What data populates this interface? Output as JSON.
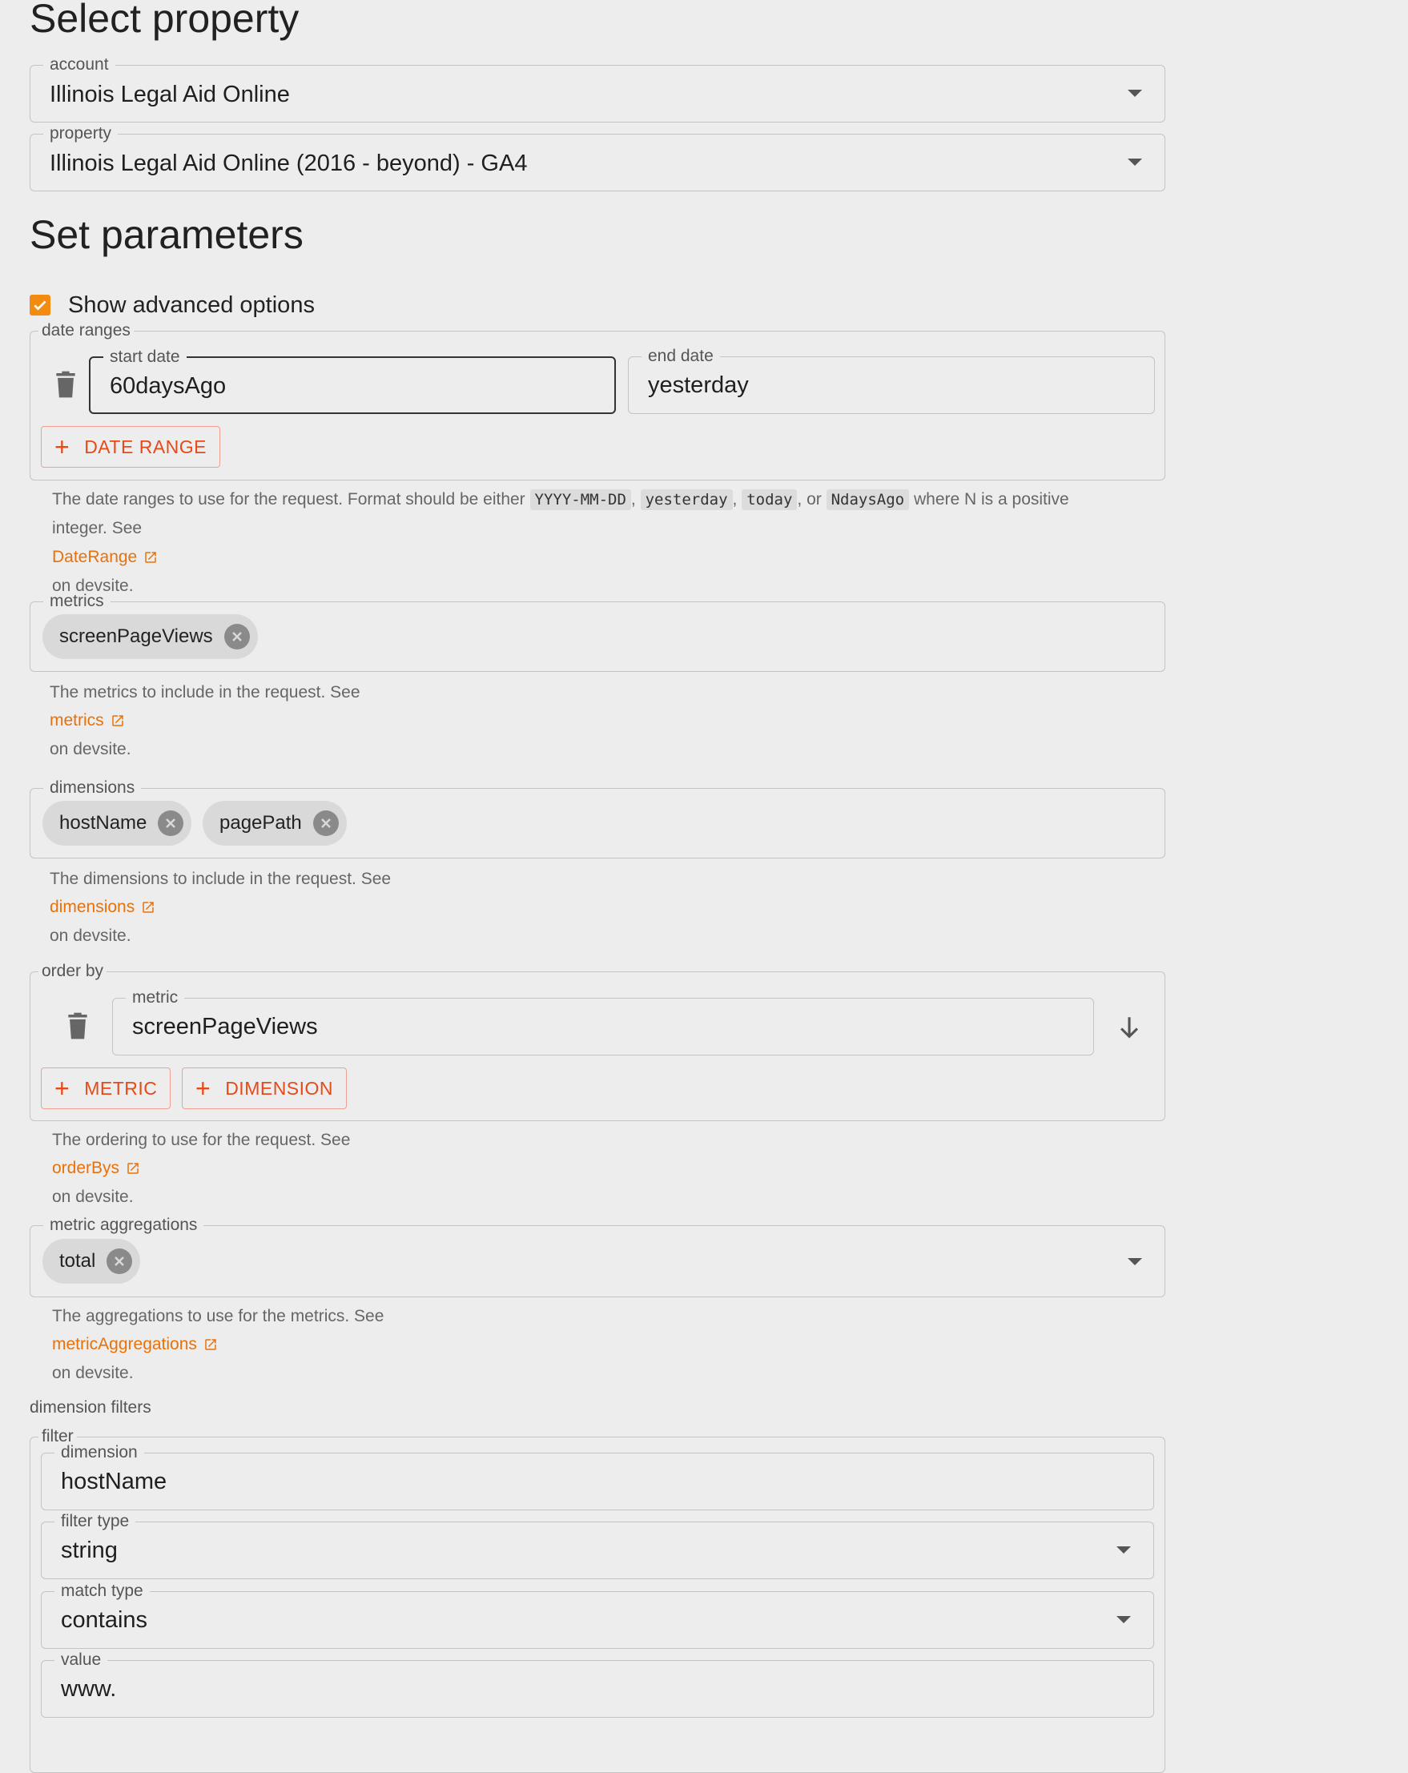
{
  "select_property": {
    "heading": "Select property",
    "account": {
      "label": "account",
      "value": "Illinois Legal Aid Online"
    },
    "property": {
      "label": "property",
      "value": "Illinois Legal Aid Online (2016 - beyond) - GA4"
    }
  },
  "set_parameters": {
    "heading": "Set parameters",
    "advanced": {
      "label": "Show advanced options",
      "checked": true
    },
    "date_ranges": {
      "legend": "date ranges",
      "start": {
        "label": "start date",
        "value": "60daysAgo"
      },
      "end": {
        "label": "end date",
        "value": "yesterday"
      },
      "add_button": "DATE RANGE",
      "help_prefix": "The date ranges to use for the request. Format should be either",
      "codes": [
        "YYYY-MM-DD",
        "yesterday",
        "today",
        "NdaysAgo"
      ],
      "help_or": ", or",
      "help_suffix": "where N is a positive",
      "help_line2": "integer. See",
      "link": "DateRange",
      "devsite": "on devsite."
    },
    "metrics": {
      "legend": "metrics",
      "chips": [
        "screenPageViews"
      ],
      "help": "The metrics to include in the request. See",
      "link": "metrics",
      "devsite": "on devsite."
    },
    "dimensions": {
      "legend": "dimensions",
      "chips": [
        "hostName",
        "pagePath"
      ],
      "help": "The dimensions to include in the request. See",
      "link": "dimensions",
      "devsite": "on devsite."
    },
    "order_by": {
      "legend": "order by",
      "metric": {
        "label": "metric",
        "value": "screenPageViews"
      },
      "add_metric": "METRIC",
      "add_dimension": "DIMENSION",
      "help": "The ordering to use for the request. See",
      "link": "orderBys",
      "devsite": "on devsite."
    },
    "metric_aggregations": {
      "legend": "metric aggregations",
      "chips": [
        "total"
      ],
      "help": "The aggregations to use for the metrics. See",
      "link": "metricAggregations",
      "devsite": "on devsite."
    },
    "dimension_filters": {
      "heading": "dimension filters",
      "filter_legend": "filter",
      "dimension": {
        "label": "dimension",
        "value": "hostName"
      },
      "filter_type": {
        "label": "filter type",
        "value": "string"
      },
      "match_type": {
        "label": "match type",
        "value": "contains"
      },
      "value": {
        "label": "value",
        "value": "www."
      }
    }
  },
  "colors": {
    "accent": "#e8710a",
    "button_text": "#e64a19",
    "checkbox": "#f28b10"
  }
}
